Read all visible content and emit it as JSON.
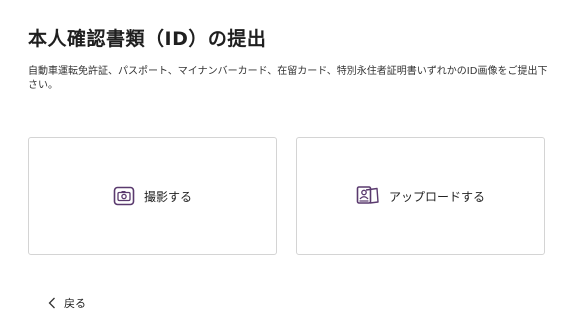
{
  "page": {
    "title": "本人確認書類（ID）の提出",
    "description": "自動車運転免許証、パスポート、マイナンバーカード、在留カード、特別永住者証明書いずれかのID画像をご提出下さい。"
  },
  "options": {
    "camera": {
      "label": "撮影する",
      "icon": "camera-icon"
    },
    "upload": {
      "label": "アップロードする",
      "icon": "id-card-upload-icon"
    }
  },
  "back": {
    "label": "戻る",
    "icon": "chevron-left-icon"
  },
  "colors": {
    "accent": "#5a3a6e",
    "border": "#d4d4d4",
    "text": "#222222"
  }
}
